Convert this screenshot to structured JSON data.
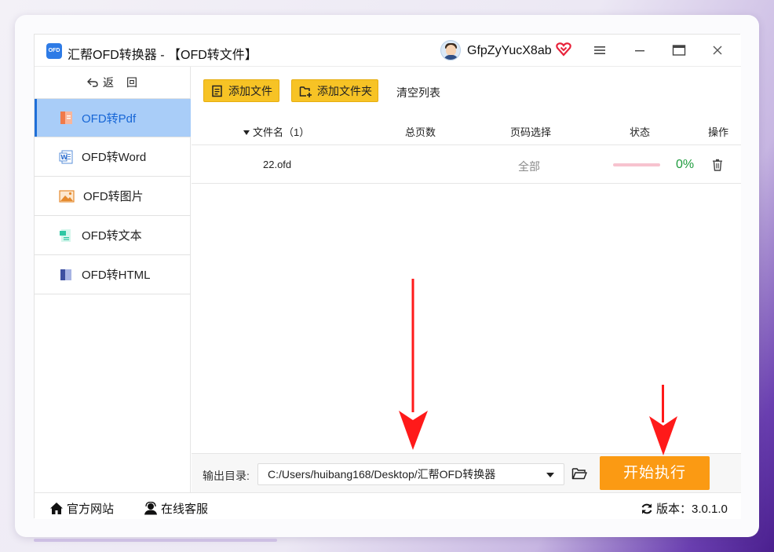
{
  "app": {
    "logo_text": "OFD",
    "title": "汇帮OFD转换器 - 【OFD转文件】",
    "username": "GfpZyYucX8ab"
  },
  "sidebar": {
    "back_label": "返　回",
    "items": [
      {
        "label": "OFD转Pdf",
        "icon": "pdf-icon",
        "active": true
      },
      {
        "label": "OFD转Word",
        "icon": "word-icon",
        "active": false
      },
      {
        "label": "OFD转图片",
        "icon": "image-icon",
        "active": false
      },
      {
        "label": "OFD转文本",
        "icon": "text-icon",
        "active": false
      },
      {
        "label": "OFD转HTML",
        "icon": "html-icon",
        "active": false
      }
    ]
  },
  "toolbar": {
    "add_file": "添加文件",
    "add_folder": "添加文件夹",
    "clear_list": "清空列表"
  },
  "table": {
    "headers": {
      "filename": "文件名（1）",
      "total_pages": "总页数",
      "page_select": "页码选择",
      "status": "状态",
      "action": "操作"
    },
    "rows": [
      {
        "filename": "22.ofd",
        "total_pages": "",
        "page_select": "全部",
        "progress": 0,
        "percent": "0%"
      }
    ]
  },
  "output": {
    "label": "输出目录:",
    "path": "C:/Users/huibang168/Desktop/汇帮OFD转换器",
    "start_button": "开始执行"
  },
  "statusbar": {
    "website": "官方网站",
    "support": "在线客服",
    "version": "版本：3.0.1.0"
  },
  "colors": {
    "accent_blue": "#1766d6",
    "active_bg": "#a9cdf8",
    "button_yellow": "#f7c325",
    "start_orange": "#fb9a13",
    "percent_green": "#1e9b3d",
    "arrow_red": "#ff1a1a"
  }
}
